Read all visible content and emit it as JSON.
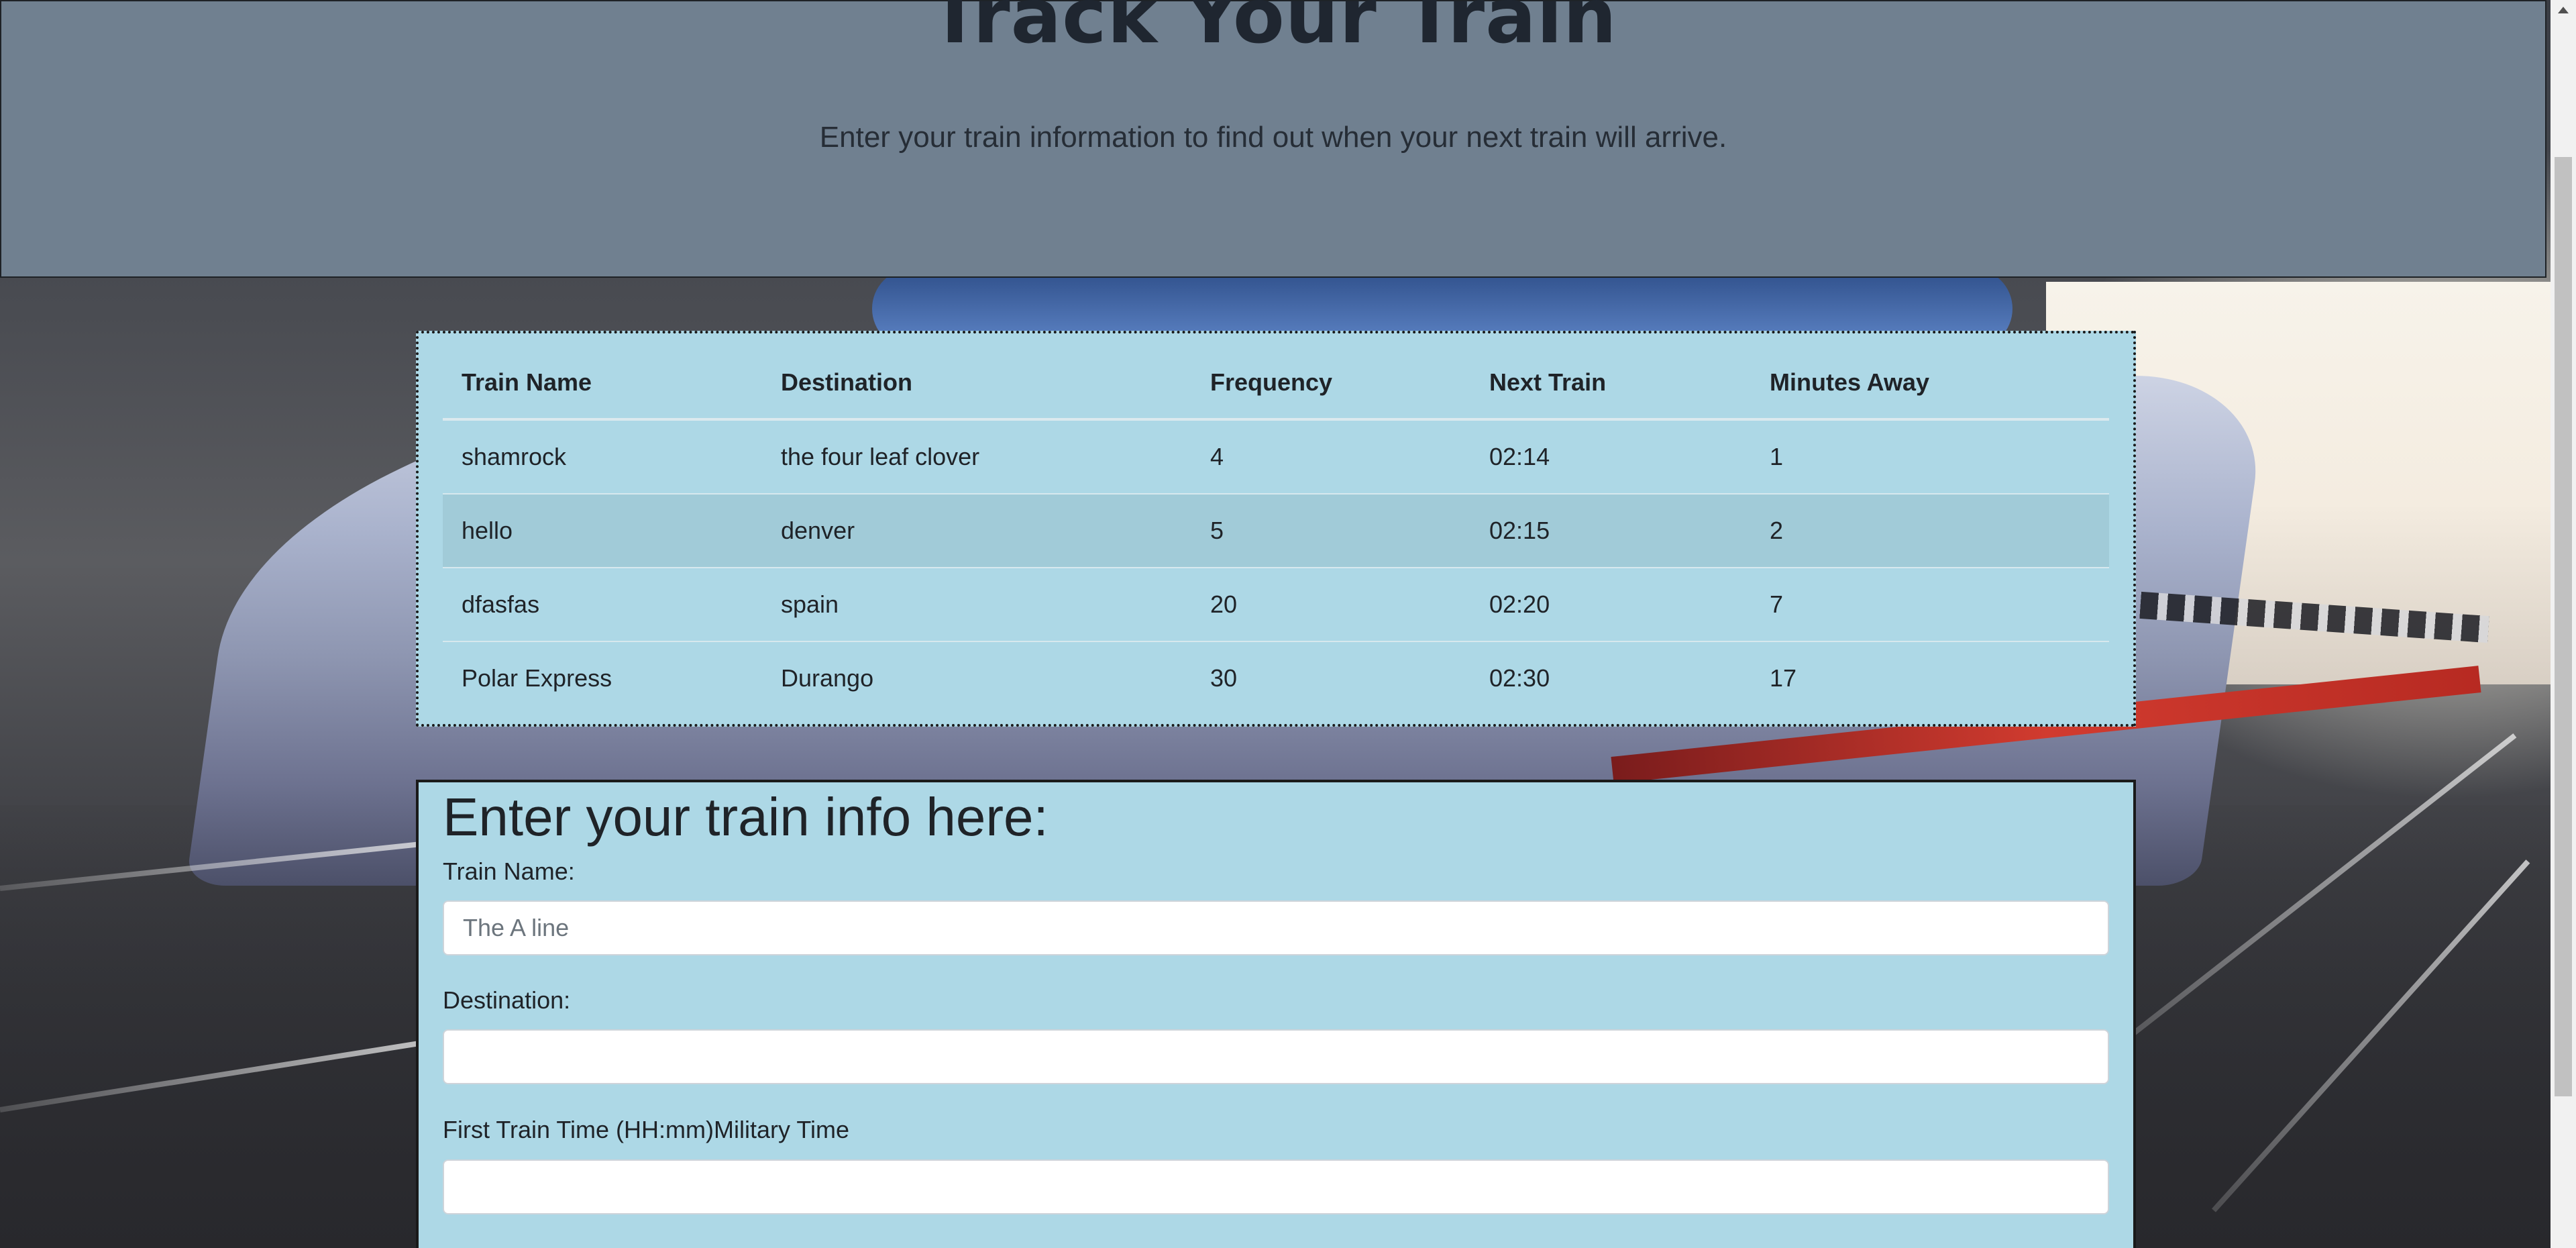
{
  "header": {
    "title": "Track Your Train",
    "subtitle": "Enter your train information to find out when your next train will arrive."
  },
  "table": {
    "columns": [
      "Train Name",
      "Destination",
      "Frequency",
      "Next Train",
      "Minutes Away"
    ],
    "rows": [
      [
        "shamrock",
        "the four leaf clover",
        "4",
        "02:14",
        "1"
      ],
      [
        "hello",
        "denver",
        "5",
        "02:15",
        "2"
      ],
      [
        "dfasfas",
        "spain",
        "20",
        "02:20",
        "7"
      ],
      [
        "Polar Express",
        "Durango",
        "30",
        "02:30",
        "17"
      ]
    ]
  },
  "form": {
    "heading": "Enter your train info here:",
    "train_name_label": "Train Name:",
    "train_name_placeholder": "The A line",
    "train_name_value": "",
    "destination_label": "Destination:",
    "destination_value": "",
    "first_time_label": "First Train Time (HH:mm)Military Time",
    "first_time_value": ""
  },
  "colors": {
    "header_bg": "#708090",
    "panel_bg": "#add8e6",
    "striped_row_bg": "#a1cbd8"
  }
}
